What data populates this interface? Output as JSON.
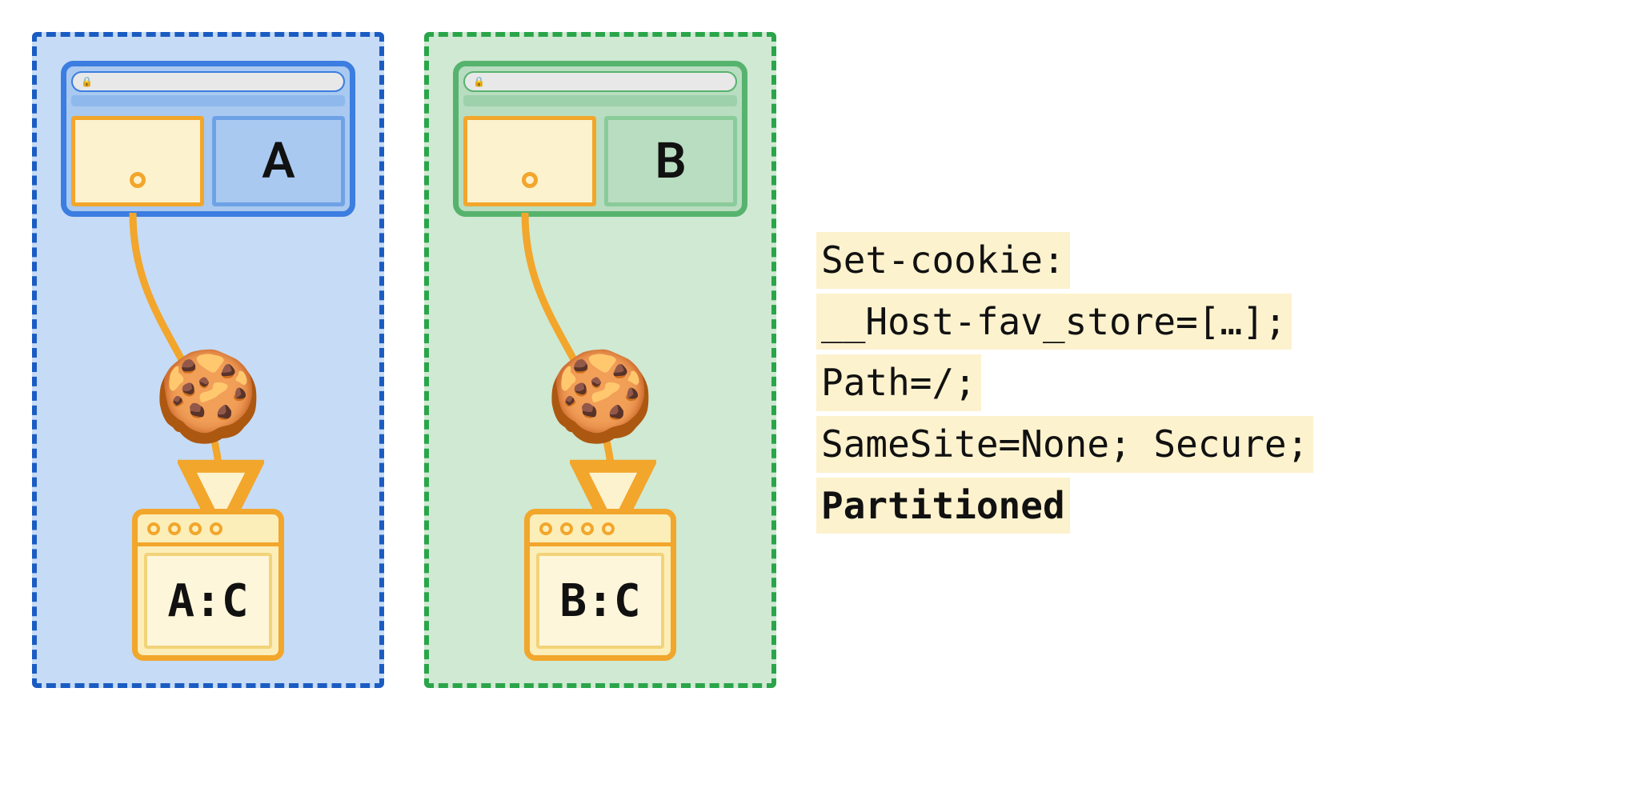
{
  "diagram": {
    "partitions": [
      {
        "id": "A",
        "color": "blue",
        "site_label": "A",
        "jar_label": "A:C"
      },
      {
        "id": "B",
        "color": "green",
        "site_label": "B",
        "jar_label": "B:C"
      }
    ],
    "cookie_icon": "🍪"
  },
  "code": {
    "line1": "Set-cookie:",
    "line2": "__Host-fav_store=[…];",
    "line3": "Path=/;",
    "line4": "SameSite=None; Secure;",
    "line5": "Partitioned"
  }
}
